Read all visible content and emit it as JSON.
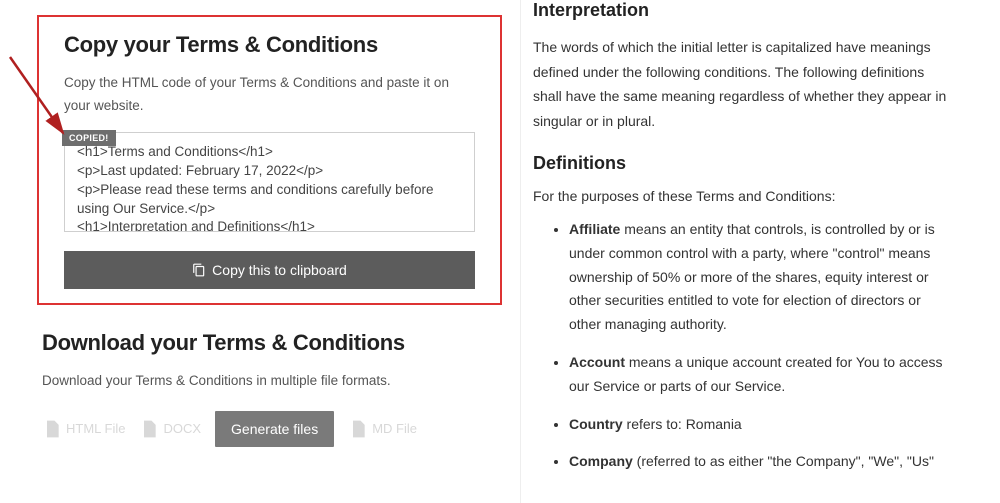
{
  "left": {
    "copy": {
      "title": "Copy your Terms & Conditions",
      "subtitle": "Copy the HTML code of your Terms & Conditions and paste it on your website.",
      "copied_badge": "COPIED!",
      "textarea_value": "<h1>Terms and Conditions</h1>\n<p>Last updated: February 17, 2022</p>\n<p>Please read these terms and conditions carefully before using Our Service.</p>\n<h1>Interpretation and Definitions</h1>",
      "button_label": "Copy this to clipboard"
    },
    "download": {
      "title": "Download your Terms & Conditions",
      "subtitle": "Download your Terms & Conditions in multiple file formats.",
      "formats": [
        "HTML File",
        "DOCX",
        "MD File"
      ],
      "generate_label": "Generate files"
    }
  },
  "right": {
    "interpretation": {
      "heading": "Interpretation",
      "body": "The words of which the initial letter is capitalized have meanings defined under the following conditions. The following definitions shall have the same meaning regardless of whether they appear in singular or in plural."
    },
    "definitions": {
      "heading": "Definitions",
      "intro": "For the purposes of these Terms and Conditions:",
      "items": [
        {
          "term": "Affiliate",
          "rest": " means an entity that controls, is controlled by or is under common control with a party, where \"control\" means ownership of 50% or more of the shares, equity interest or other securities entitled to vote for election of directors or other managing authority."
        },
        {
          "term": "Account",
          "rest": " means a unique account created for You to access our Service or parts of our Service."
        },
        {
          "term": "Country",
          "rest": " refers to: Romania"
        },
        {
          "term": "Company",
          "rest": " (referred to as either \"the Company\", \"We\", \"Us\""
        }
      ]
    }
  }
}
